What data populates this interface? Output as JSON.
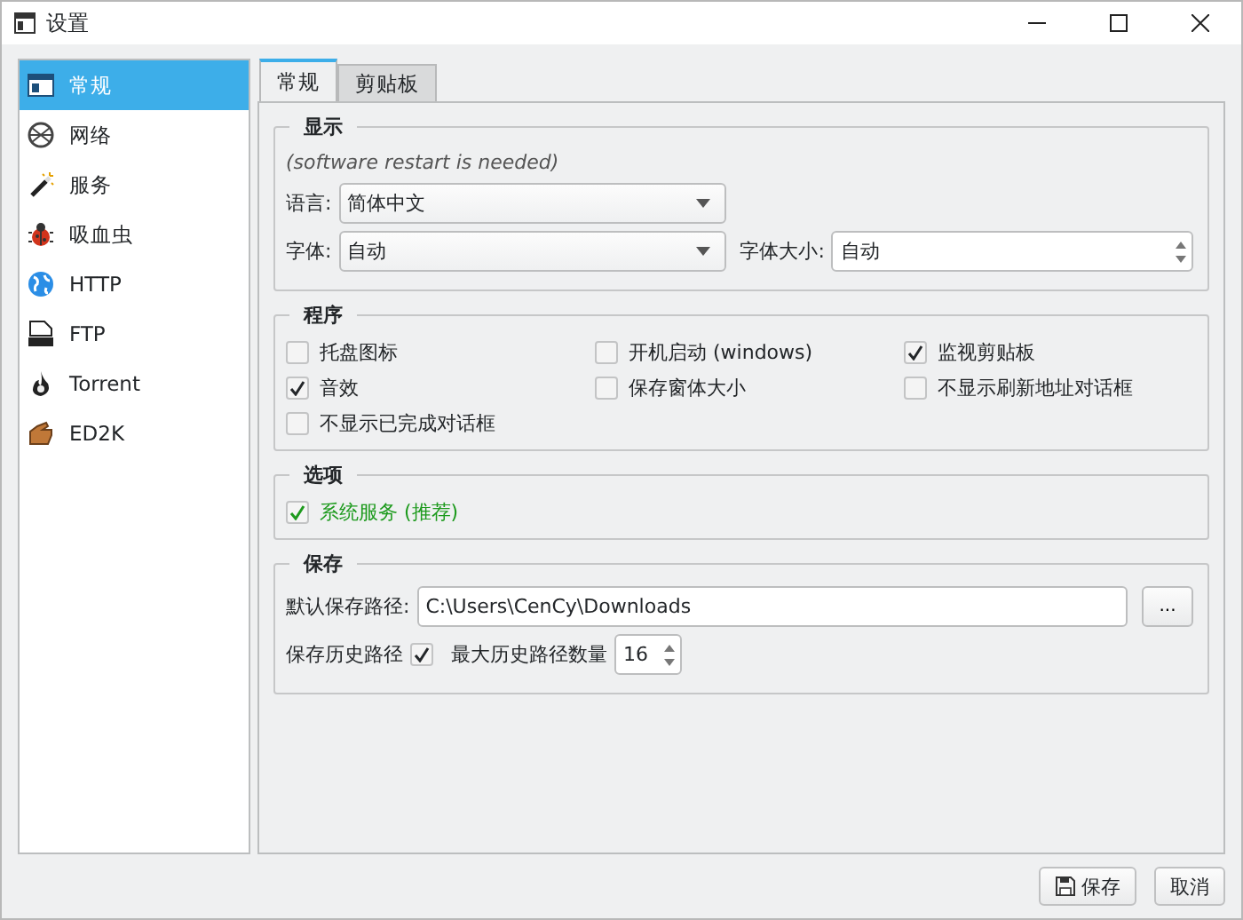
{
  "window": {
    "title": "设置"
  },
  "sidebar": {
    "items": [
      {
        "label": "常规",
        "kind": "general",
        "selected": true
      },
      {
        "label": "网络",
        "kind": "network",
        "selected": false
      },
      {
        "label": "服务",
        "kind": "service",
        "selected": false
      },
      {
        "label": "吸血虫",
        "kind": "bug",
        "selected": false
      },
      {
        "label": "HTTP",
        "kind": "http",
        "selected": false
      },
      {
        "label": "FTP",
        "kind": "ftp",
        "selected": false
      },
      {
        "label": "Torrent",
        "kind": "torrent",
        "selected": false
      },
      {
        "label": "ED2K",
        "kind": "ed2k",
        "selected": false
      }
    ]
  },
  "tabs": [
    {
      "label": "常规",
      "selected": true
    },
    {
      "label": "剪贴板",
      "selected": false
    }
  ],
  "display": {
    "title": "显示",
    "note": "(software restart is needed)",
    "language": {
      "label": "语言:",
      "value": "简体中文"
    },
    "font": {
      "label": "字体:",
      "value": "自动"
    },
    "font_size": {
      "label": "字体大小:",
      "value": "自动"
    }
  },
  "program": {
    "title": "程序",
    "checkboxes": [
      {
        "label": "托盘图标",
        "checked": false
      },
      {
        "label": "开机启动 (windows)",
        "checked": false
      },
      {
        "label": "监视剪贴板",
        "checked": true
      },
      {
        "label": "音效",
        "checked": true
      },
      {
        "label": "保存窗体大小",
        "checked": false
      },
      {
        "label": "不显示刷新地址对话框",
        "checked": false
      },
      {
        "label": "不显示已完成对话框",
        "checked": false
      }
    ]
  },
  "options": {
    "title": "选项",
    "checkboxes": [
      {
        "label": "系统服务 (推荐)",
        "checked": true,
        "kind": "recommended"
      }
    ]
  },
  "save": {
    "title": "保存",
    "path_label": "默认保存路径:",
    "path_value": "C:\\Users\\CenCy\\Downloads",
    "browse_button": "...",
    "history": {
      "label": "保存历史路径",
      "checked": true
    },
    "max_history": {
      "label": "最大历史路径数量",
      "value": "16"
    }
  },
  "buttons": [
    {
      "label": "保存",
      "kind": "save"
    },
    {
      "label": "取消",
      "kind": "cancel"
    }
  ]
}
